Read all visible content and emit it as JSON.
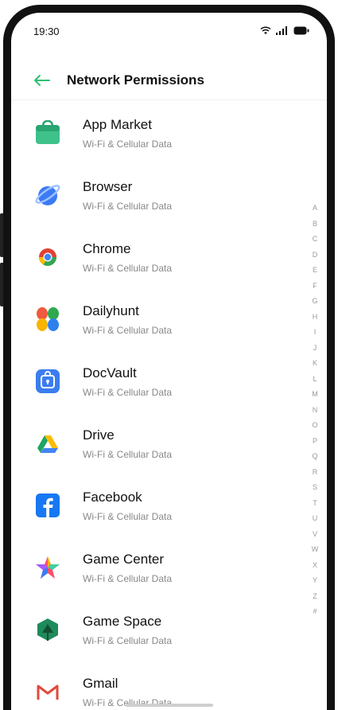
{
  "status_bar": {
    "time": "19:30",
    "wifi_icon": "wifi-icon",
    "signal_icon": "signal-icon",
    "battery_icon": "battery-icon"
  },
  "header": {
    "back_icon": "arrow-left-icon",
    "title": "Network Permissions",
    "accent_color": "#2fbf71"
  },
  "apps": [
    {
      "name": "App Market",
      "subtitle": "Wi-Fi & Cellular Data",
      "icon": "app-market-icon"
    },
    {
      "name": "Browser",
      "subtitle": "Wi-Fi & Cellular Data",
      "icon": "browser-icon"
    },
    {
      "name": "Chrome",
      "subtitle": "Wi-Fi & Cellular Data",
      "icon": "chrome-icon"
    },
    {
      "name": "Dailyhunt",
      "subtitle": "Wi-Fi & Cellular Data",
      "icon": "dailyhunt-icon"
    },
    {
      "name": "DocVault",
      "subtitle": "Wi-Fi & Cellular Data",
      "icon": "docvault-icon"
    },
    {
      "name": "Drive",
      "subtitle": "Wi-Fi & Cellular Data",
      "icon": "drive-icon"
    },
    {
      "name": "Facebook",
      "subtitle": "Wi-Fi & Cellular Data",
      "icon": "facebook-icon"
    },
    {
      "name": "Game Center",
      "subtitle": "Wi-Fi & Cellular Data",
      "icon": "game-center-icon"
    },
    {
      "name": "Game Space",
      "subtitle": "Wi-Fi & Cellular Data",
      "icon": "game-space-icon"
    },
    {
      "name": "Gmail",
      "subtitle": "Wi-Fi & Cellular Data",
      "icon": "gmail-icon"
    }
  ],
  "alphabet_index": [
    "A",
    "B",
    "C",
    "D",
    "E",
    "F",
    "G",
    "H",
    "I",
    "J",
    "K",
    "L",
    "M",
    "N",
    "O",
    "P",
    "Q",
    "R",
    "S",
    "T",
    "U",
    "V",
    "W",
    "X",
    "Y",
    "Z",
    "#"
  ]
}
